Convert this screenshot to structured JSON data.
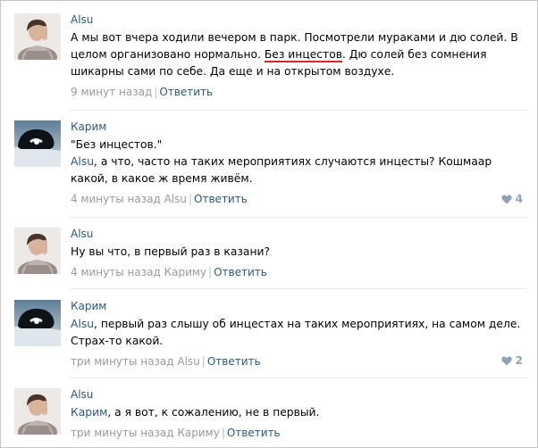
{
  "comments": [
    {
      "author": "Alsu",
      "text_before": "А мы вот вчера ходили вечером в парк. Посмотрели мураками и дю солей. В целом организовано нормально. ",
      "text_underlined": "Без инцестов",
      "text_after": ". Дю солей без сомнения шикарны сами по себе. Да еще и на открытом воздухе.",
      "time": "9 минут назад",
      "reply_label": "Ответить"
    },
    {
      "author": "Карим",
      "quote": "\"Без инцестов.\"",
      "mention": "Alsu",
      "text": ", а что, часто на таких мероприятиях случаются инцесты? Кошмаар какой, в какое ж время живём.",
      "time": "4 минуты назад",
      "reply_to": "Alsu",
      "reply_label": "Ответить",
      "likes": "4"
    },
    {
      "author": "Alsu",
      "text": "Ну вы что, в первый раз в казани?",
      "time": "4 минуты назад",
      "reply_to": "Кариму",
      "reply_label": "Ответить"
    },
    {
      "author": "Карим",
      "mention": "Alsu",
      "text": ", первый раз слышу об инцестах на таких мероприятиях, на самом деле. Страх-то какой.",
      "time": "три минуты назад",
      "reply_to": "Alsu",
      "reply_label": "Ответить",
      "likes": "2"
    },
    {
      "author": "Alsu",
      "mention": "Карим",
      "text": ", а я вот, к сожалению, не в первый.",
      "time": "три минуты назад",
      "reply_to": "Кариму",
      "reply_label": "Ответить"
    }
  ],
  "colors": {
    "link": "#2b587a",
    "meta": "#999999",
    "like": "#8fa1b4",
    "underline": "#d9262b"
  },
  "icons": {
    "like": "heart-icon"
  }
}
